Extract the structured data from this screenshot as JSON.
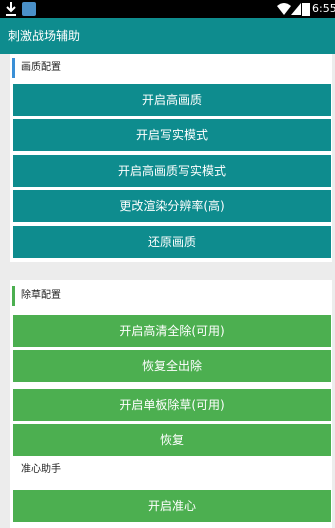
{
  "status_bar": {
    "time": "6:55",
    "icons": [
      "download-icon",
      "app-notification-icon",
      "wifi-icon",
      "signal-icon",
      "battery-icon"
    ]
  },
  "app_bar": {
    "title": "刺激战场辅助"
  },
  "colors": {
    "primary_teal": "#0e8c8e",
    "green": "#4caf50",
    "section_bar_blue": "#3a8fd6",
    "section_bar_green": "#4caf50",
    "background": "#ececec"
  },
  "sections": [
    {
      "title": "画质配置",
      "buttons": [
        {
          "label": "开启高画质"
        },
        {
          "label": "开启写实模式"
        },
        {
          "label": "开启高画质写实模式"
        },
        {
          "label": "更改渲染分辨率(高)"
        },
        {
          "label": "还原画质"
        }
      ]
    },
    {
      "title": "除草配置",
      "buttons": [
        {
          "label": "开启高清全除(可用)"
        },
        {
          "label": "恢复全出除"
        },
        {
          "label": "开启单板除草(可用)"
        },
        {
          "label": "恢复"
        }
      ]
    },
    {
      "title": "准心助手",
      "buttons": [
        {
          "label": "开启准心"
        }
      ]
    }
  ]
}
